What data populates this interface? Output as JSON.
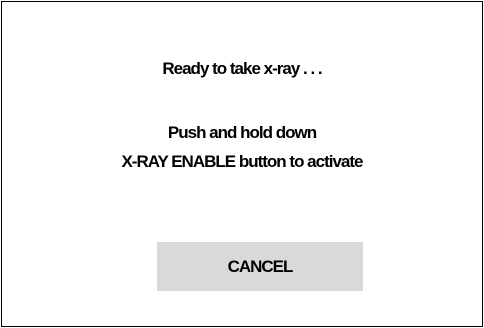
{
  "dialog": {
    "ready_text": "Ready to take x-ray . . .",
    "instruction_line1": "Push and hold down",
    "instruction_line2": "X-RAY ENABLE button to activate",
    "cancel_label": "CANCEL"
  },
  "colors": {
    "background": "#ffffff",
    "border": "#000000",
    "button_background": "#d9d9d9",
    "text": "#000000"
  }
}
